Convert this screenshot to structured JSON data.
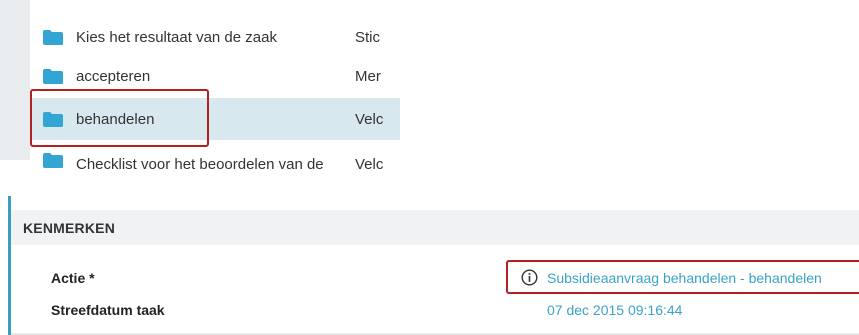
{
  "colors": {
    "folder": "#33a5d4",
    "selected_row": "#d7e8ee",
    "highlight_border": "#b32020",
    "link": "#3aa3c9",
    "panel_accent": "#3a9ec2"
  },
  "task_list": {
    "rows": [
      {
        "name": "Kies het resultaat van de zaak",
        "col2": "Stic",
        "icon": "folder-icon",
        "selected": false
      },
      {
        "name": "accepteren",
        "col2": "Mer",
        "icon": "folder-icon",
        "selected": false
      },
      {
        "name": "behandelen",
        "col2": "Velc",
        "icon": "folder-icon",
        "selected": true
      },
      {
        "name": "Checklist voor het beoordelen van de",
        "col2": "Velc",
        "icon": "folder-icon",
        "selected": false
      }
    ]
  },
  "kenmerken": {
    "title": "KENMERKEN",
    "fields": [
      {
        "label": "Actie *",
        "value": "Subsidieaanvraag behandelen - behandelen",
        "icon": "info-icon"
      },
      {
        "label": "Streefdatum taak",
        "value": "07 dec 2015 09:16:44"
      }
    ]
  }
}
